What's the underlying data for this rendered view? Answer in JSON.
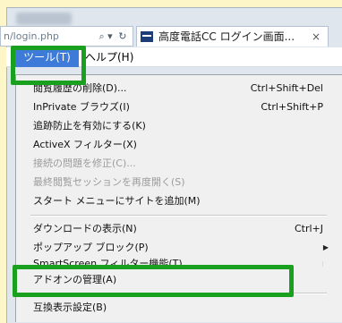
{
  "address_bar": {
    "url": "n/login.php",
    "refresh_icon": "refresh-icon",
    "dropdown_icon": "dropdown-icon"
  },
  "tab": {
    "title": "高度電話CC ログイン画面...",
    "close": "×"
  },
  "menubar": {
    "tools": "ツール(T)",
    "help": "ヘルプ(H)"
  },
  "menu": {
    "items": [
      {
        "label": "閲覧履歴の削除(D)...",
        "shortcut": "Ctrl+Shift+Del"
      },
      {
        "label": "InPrivate ブラウズ(I)",
        "shortcut": "Ctrl+Shift+P"
      },
      {
        "label": "追跡防止を有効にする(K)",
        "shortcut": ""
      },
      {
        "label": "ActiveX フィルター(X)",
        "shortcut": ""
      },
      {
        "label": "接続の問題を修正(C)...",
        "shortcut": ""
      },
      {
        "label": "最終閲覧セッションを再度開く(S)",
        "shortcut": ""
      },
      {
        "label": "スタート メニューにサイトを追加(M)",
        "shortcut": ""
      },
      {
        "label": "ダウンロードの表示(N)",
        "shortcut": "Ctrl+J"
      },
      {
        "label": "ポップアップ ブロック(P)",
        "shortcut": ""
      },
      {
        "label": "SmartScreen フィルター機能(T)",
        "shortcut": ""
      },
      {
        "label": "アドオンの管理(A)",
        "shortcut": ""
      },
      {
        "label": "互換表示設定(B)",
        "shortcut": ""
      }
    ]
  },
  "colors": {
    "highlight_box": "#19a01e",
    "menu_selected": "#3e7ad8",
    "page_bg": "#fdf6c8"
  }
}
